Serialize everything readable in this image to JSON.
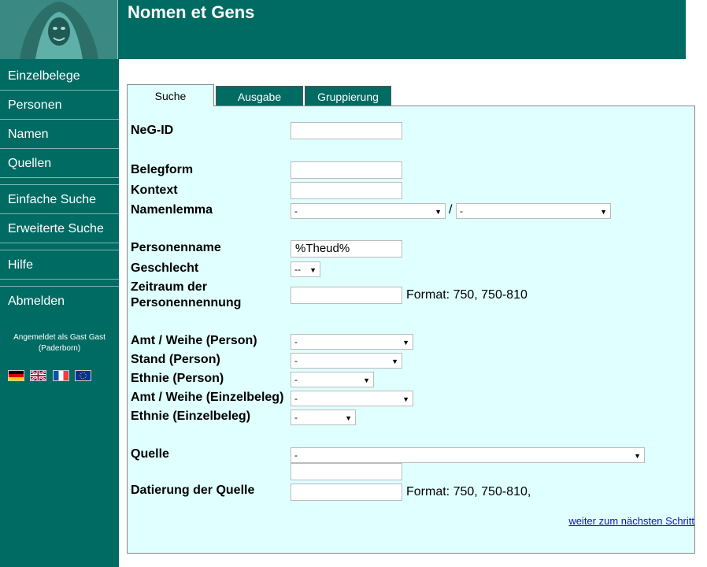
{
  "app": {
    "title": "Nomen et Gens"
  },
  "nav": {
    "items": [
      "Einzelbelege",
      "Personen",
      "Namen",
      "Quellen",
      "Einfache Suche",
      "Erweiterte Suche",
      "Hilfe",
      "Abmelden"
    ]
  },
  "login": {
    "line1": "Angemeldet als Gast Gast",
    "line2": "(Paderborn)"
  },
  "flags": [
    "de",
    "en",
    "fr",
    "eu"
  ],
  "tabs": [
    "Suche",
    "Ausgabe",
    "Gruppierung"
  ],
  "form": {
    "neg_id": "NeG-ID",
    "belegform": "Belegform",
    "kontext": "Kontext",
    "namenlemma": "Namenlemma",
    "namenlemma_sel1": "-",
    "namenlemma_sep": "/",
    "namenlemma_sel2": "-",
    "personenname": "Personenname",
    "personenname_value": "%Theud%",
    "geschlecht": "Geschlecht",
    "geschlecht_value": "--",
    "zeitraum_line1": "Zeitraum der",
    "zeitraum_line2": "Personennennung",
    "zeitraum_format": "Format: 750, 750-810",
    "amt_person": "Amt / Weihe (Person)",
    "amt_person_value": "-",
    "stand_person": "Stand (Person)",
    "stand_person_value": "-",
    "ethnie_person": "Ethnie (Person)",
    "ethnie_person_value": "-",
    "amt_beleg": "Amt / Weihe (Einzelbeleg)",
    "amt_beleg_value": "-",
    "ethnie_beleg": "Ethnie (Einzelbeleg)",
    "ethnie_beleg_value": "-",
    "quelle": "Quelle",
    "quelle_value": "-",
    "datierung": "Datierung der Quelle",
    "datierung_format": "Format: 750, 750-810,",
    "next_link": "weiter zum nächsten Schritt"
  }
}
